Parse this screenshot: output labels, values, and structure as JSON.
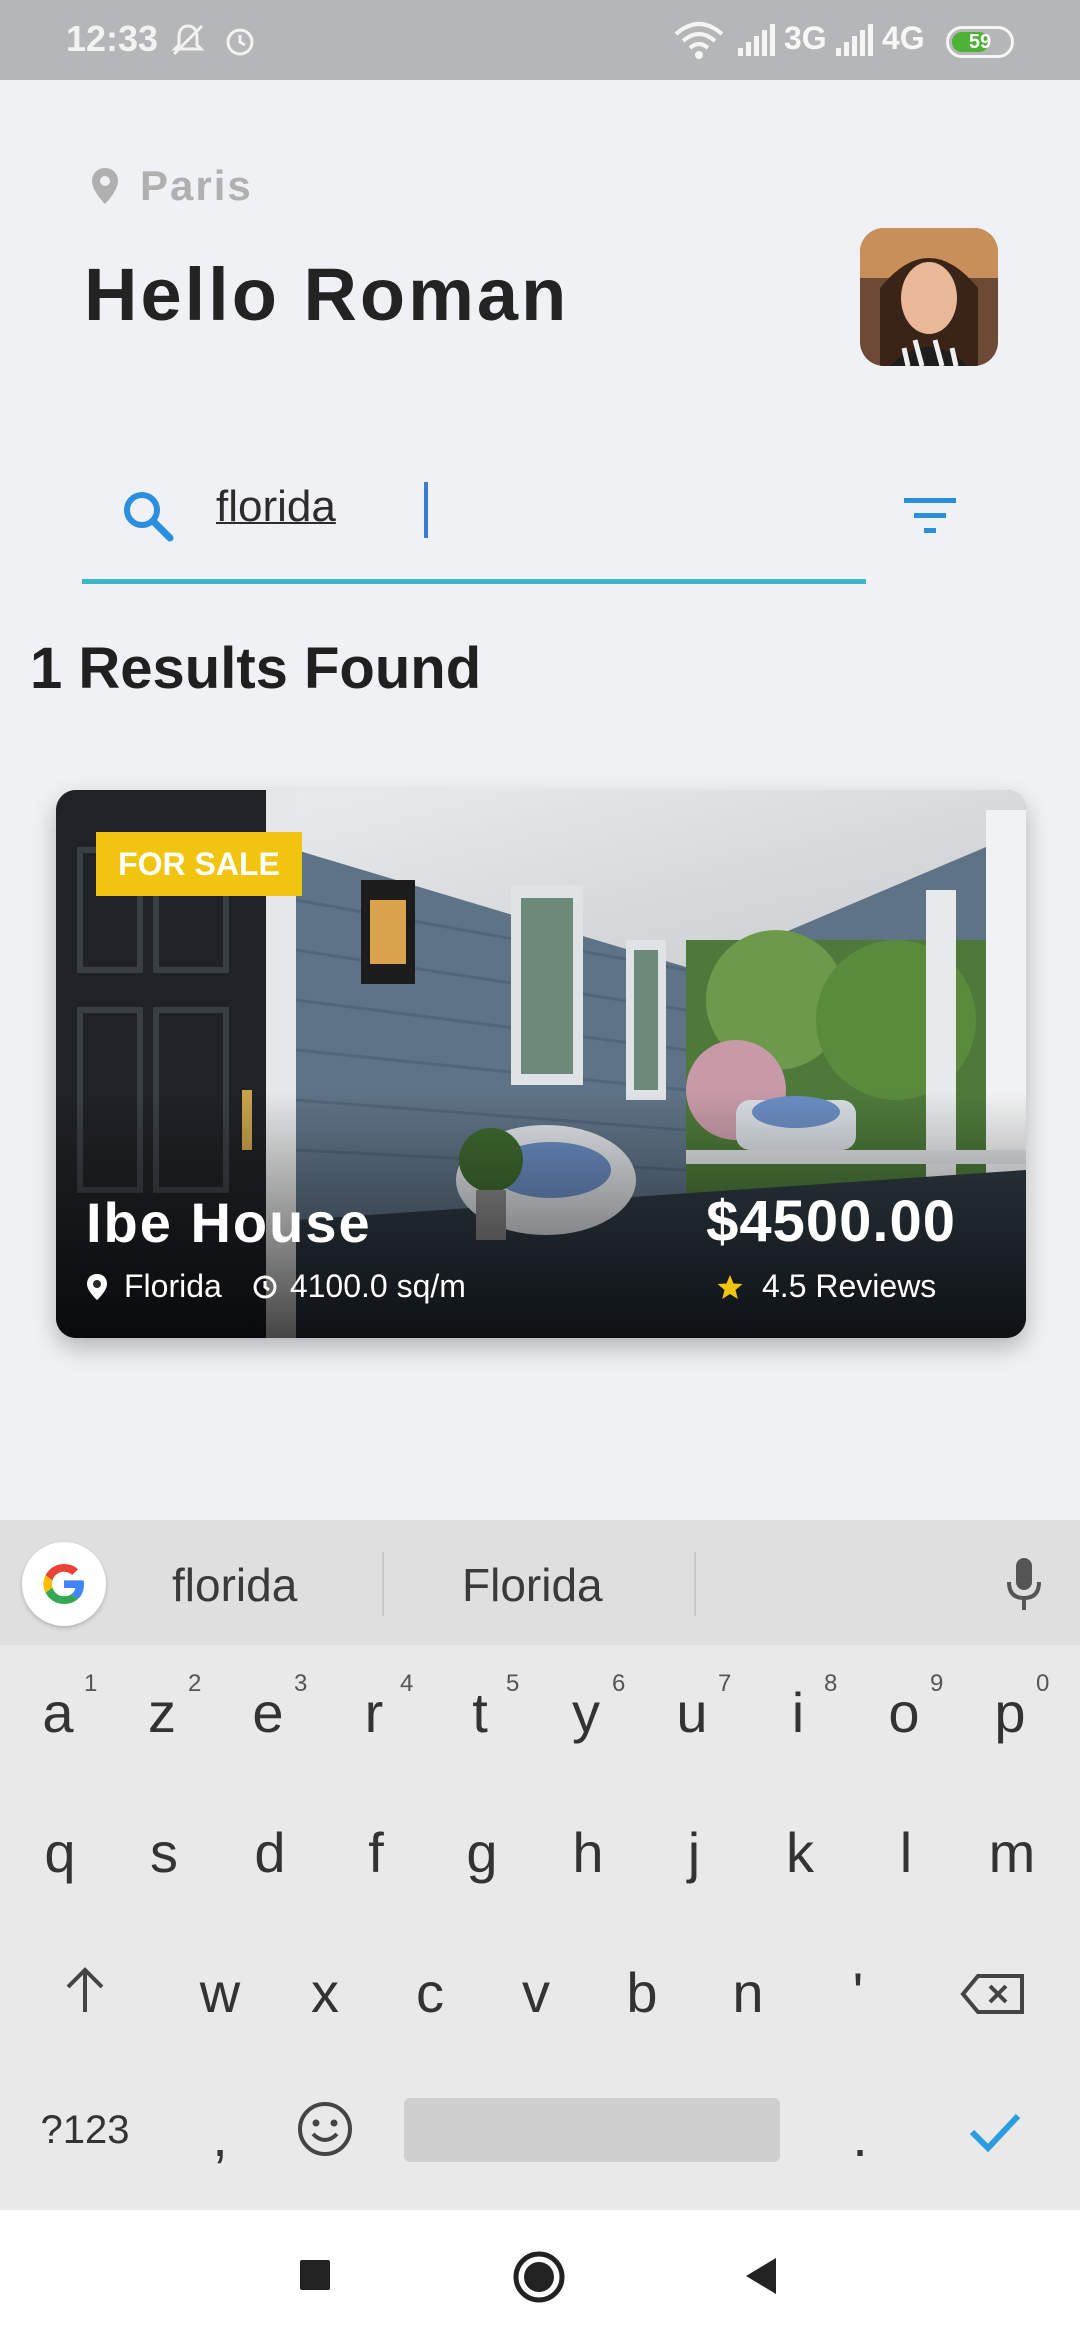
{
  "status_bar": {
    "time": "12:33",
    "network_3g": "3G",
    "network_4g": "4G",
    "battery": "59"
  },
  "header": {
    "location": "Paris",
    "greeting": "Hello Roman"
  },
  "search": {
    "value": "florida"
  },
  "results_label": "1 Results Found",
  "card": {
    "badge": "FOR SALE",
    "title": "Ibe House",
    "price": "$4500.00",
    "location": "Florida",
    "area": "4100.0 sq/m",
    "reviews": "4.5 Reviews"
  },
  "keyboard": {
    "suggestions": [
      "florida",
      "Florida"
    ],
    "row1": [
      "a",
      "z",
      "e",
      "r",
      "t",
      "y",
      "u",
      "i",
      "o",
      "p"
    ],
    "row1_nums": [
      "1",
      "2",
      "3",
      "4",
      "5",
      "6",
      "7",
      "8",
      "9",
      "0"
    ],
    "row2": [
      "q",
      "s",
      "d",
      "f",
      "g",
      "h",
      "j",
      "k",
      "l",
      "m"
    ],
    "row3": [
      "w",
      "x",
      "c",
      "v",
      "b",
      "n",
      "'"
    ],
    "symbols_key": "?123",
    "comma": ",",
    "period": "."
  },
  "colors": {
    "accent": "#3bb7c9",
    "badge": "#f1c40f",
    "star": "#f1c40f",
    "check": "#2a9de0"
  }
}
